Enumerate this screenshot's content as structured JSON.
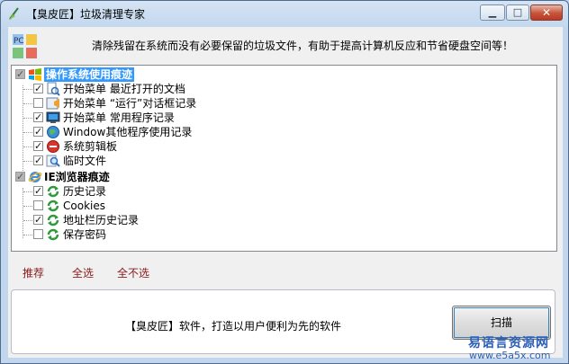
{
  "window": {
    "title": "【臭皮匠】垃圾清理专家"
  },
  "controls": {
    "min": "▁",
    "max": "□",
    "close": "✕"
  },
  "header": {
    "text": "清除残留在系统而没有必要保留的垃圾文件，有助于提高计算机反应和节省硬盘空间等！",
    "logo_text": "PC",
    "logo_icon": "pc-cleaner-logo"
  },
  "tree": {
    "groups": [
      {
        "label": "操作系统使用痕迹",
        "checked": true,
        "icon": "windows-flag-icon",
        "items": [
          {
            "label": "开始菜单  最近打开的文档",
            "checked": true,
            "icon": "search-document-icon"
          },
          {
            "label": "开始菜单  “运行”对话框记录",
            "checked": false,
            "icon": "run-dialog-icon"
          },
          {
            "label": "开始菜单  常用程序记录",
            "checked": true,
            "icon": "monitor-icon"
          },
          {
            "label": "Window其他程序使用记录",
            "checked": true,
            "icon": "globe-icon"
          },
          {
            "label": "系统剪辑板",
            "checked": true,
            "icon": "clipboard-icon"
          },
          {
            "label": "临时文件",
            "checked": true,
            "icon": "magnifier-icon"
          }
        ]
      },
      {
        "label": "IE浏览器痕迹",
        "checked": true,
        "icon": "ie-icon",
        "items": [
          {
            "label": "历史记录",
            "checked": true,
            "icon": "refresh-icon"
          },
          {
            "label": "Cookies",
            "checked": false,
            "icon": "refresh-icon"
          },
          {
            "label": "地址栏历史记录",
            "checked": true,
            "icon": "refresh-icon"
          },
          {
            "label": "保存密码",
            "checked": false,
            "icon": "refresh-icon"
          }
        ]
      }
    ]
  },
  "actions": {
    "recommend": "推荐",
    "select_all": "全选",
    "select_none": "全不选"
  },
  "footer": {
    "slogan": "【臭皮匠】软件，打造以用户便利为先的软件",
    "scan": "扫描"
  },
  "watermark": {
    "line1": "易语言资源网",
    "line2": "www.e5a5x.com"
  }
}
